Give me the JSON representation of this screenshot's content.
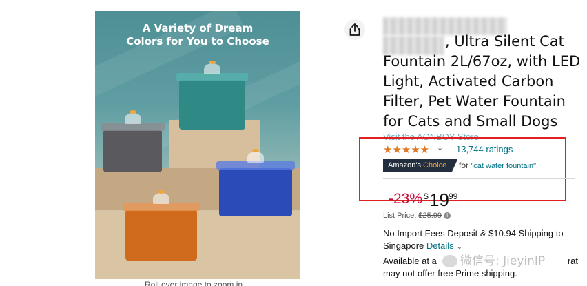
{
  "image": {
    "headline_line1": "A Variety of Dream",
    "headline_line2": "Colors for You to Choose",
    "zoom_hint": "Roll over image to zoom in",
    "fountain_colors": [
      "#5a5a5e",
      "#2f8a86",
      "#2a4bb8",
      "#d06a1d"
    ]
  },
  "share": {
    "icon": "share-icon"
  },
  "product": {
    "title": ", Ultra Silent Cat Fountain 2L/67oz, with LED Light, Activated Carbon Filter, Pet Water Fountain for Cats and Small Dogs",
    "store_link": "Visit the AONBOY Store"
  },
  "rating": {
    "stars": "★★★★★",
    "value": 4.5,
    "count_label": "13,744 ratings"
  },
  "badge": {
    "amazons": "Amazon's",
    "choice": "Choice",
    "for_label": "for",
    "keyword": "\"cat water fountain\""
  },
  "price": {
    "discount": "-23%",
    "symbol": "$",
    "whole": "19",
    "fraction": "99",
    "list_label": "List Price:",
    "list_value": "$25.99"
  },
  "shipping": {
    "text": "No Import Fees Deposit & $10.94 Shipping to Singapore",
    "details": "Details"
  },
  "availability": {
    "line1_prefix": "Available at a",
    "line1_suffix": "rat",
    "line2": "may not offer free Prime shipping."
  },
  "watermark": "微信号: JieyinIP",
  "colors": {
    "accent_link": "#007185",
    "star": "#de7921",
    "deal_red": "#cc0c39",
    "highlight": "#e02020"
  }
}
